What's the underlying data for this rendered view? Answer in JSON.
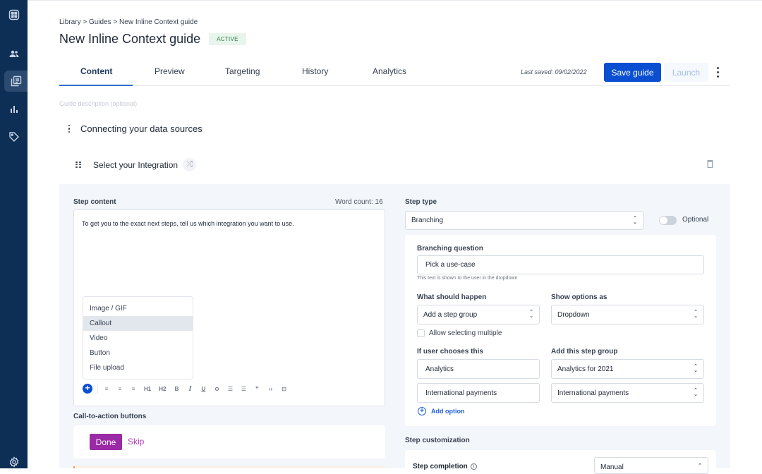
{
  "sidebar": {
    "items": [
      {
        "icon": "apps-grid-icon"
      },
      {
        "icon": "users-icon"
      },
      {
        "icon": "guides-icon",
        "active": true
      },
      {
        "icon": "analytics-icon"
      },
      {
        "icon": "tag-icon"
      },
      {
        "icon": "settings-gear-icon"
      }
    ]
  },
  "header": {
    "breadcrumb": "Library > Guides > New Inline Context guide",
    "title": "New Inline Context guide",
    "status_badge": "ACTIVE"
  },
  "tabs": [
    {
      "label": "Content",
      "active": true
    },
    {
      "label": "Preview"
    },
    {
      "label": "Targeting"
    },
    {
      "label": "History"
    },
    {
      "label": "Analytics"
    }
  ],
  "toolbar": {
    "last_saved": "Last saved: 09/02/2022",
    "save_label": "Save guide",
    "launch_label": "Launch"
  },
  "guide": {
    "description_placeholder": "Guide description (optional)",
    "section_title": "Connecting your data sources",
    "step_name": "Select your Integration"
  },
  "step_content": {
    "label": "Step content",
    "word_count": "Word count: 16",
    "body": "To get you to the exact next steps, tell us which integration you want to use.",
    "insert_menu": [
      "Image / GIF",
      "Callout",
      "Video",
      "Button",
      "File upload"
    ],
    "insert_menu_highlighted": "Callout",
    "format_tools": [
      "align-left",
      "align-center",
      "align-right",
      "H1",
      "H2",
      "B",
      "I",
      "U",
      "link",
      "bulleted-list",
      "numbered-list",
      "quote",
      "code",
      "embed"
    ]
  },
  "cta": {
    "label": "Call-to-action buttons",
    "primary": "Done",
    "secondary": "Skip",
    "primary_color": "#9a2aa5"
  },
  "step_type": {
    "label": "Step type",
    "value": "Branching",
    "optional_label": "Optional",
    "optional_on": false
  },
  "branching": {
    "question_label": "Branching question",
    "question_value": "Pick a use-case",
    "question_hint": "This text is shown to the user in the dropdown",
    "what_happens_label": "What should happen",
    "what_happens_value": "Add a step group",
    "show_as_label": "Show options as",
    "show_as_value": "Dropdown",
    "allow_multiple_label": "Allow selecting multiple",
    "allow_multiple_checked": false,
    "choice_col_label": "If user chooses this",
    "group_col_label": "Add this step group",
    "options": [
      {
        "choice": "Analytics",
        "group": "Analytics for 2021"
      },
      {
        "choice": "International payments",
        "group": "International payments"
      }
    ],
    "add_option_label": "Add option"
  },
  "customization": {
    "label": "Step customization",
    "completion_label": "Step completion",
    "completion_value": "Manual"
  },
  "colors": {
    "sidebar_bg": "#0d2e55",
    "accent_blue": "#0a4fd1",
    "badge_green": "#2f7a45"
  }
}
